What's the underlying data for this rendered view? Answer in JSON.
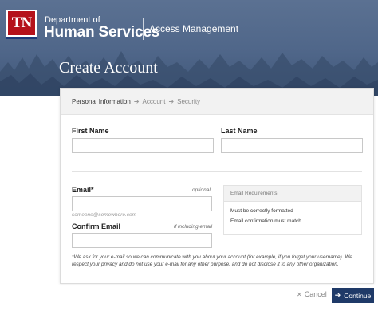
{
  "header": {
    "logo_text": "TN",
    "dept_line1": "Department of",
    "dept_line2": "Human Services",
    "app_name": "Access Management"
  },
  "page": {
    "title": "Create Account"
  },
  "steps": [
    {
      "label": "Personal Information",
      "active": true
    },
    {
      "label": "Account",
      "active": false
    },
    {
      "label": "Security",
      "active": false
    }
  ],
  "form": {
    "first_name_label": "First Name",
    "first_name_value": "",
    "last_name_label": "Last Name",
    "last_name_value": "",
    "email_label": "Email*",
    "email_optional": "optional",
    "email_value": "",
    "email_helper": "someone@somewhere.com",
    "confirm_label": "Confirm Email",
    "confirm_hint": "if including email",
    "confirm_value": ""
  },
  "requirements": {
    "title": "Email Requirements",
    "items": [
      "Must be correctly formatted",
      "Email confirmation must match"
    ]
  },
  "notice": "*We ask for your e-mail so we can communicate with you about your account (for example, if you forget your username). We respect your privacy and do not use your e-mail for any other purpose, and do not disclose it to any other organization.",
  "buttons": {
    "cancel": "Cancel",
    "continue": "Continue"
  },
  "icons": {
    "cancel": "close-icon",
    "continue": "arrow-right-icon",
    "step_separator": "chevron-right-icon"
  },
  "colors": {
    "hero": "#4f6689",
    "primary_button": "#1f3a68",
    "logo_red": "#b5121b"
  }
}
